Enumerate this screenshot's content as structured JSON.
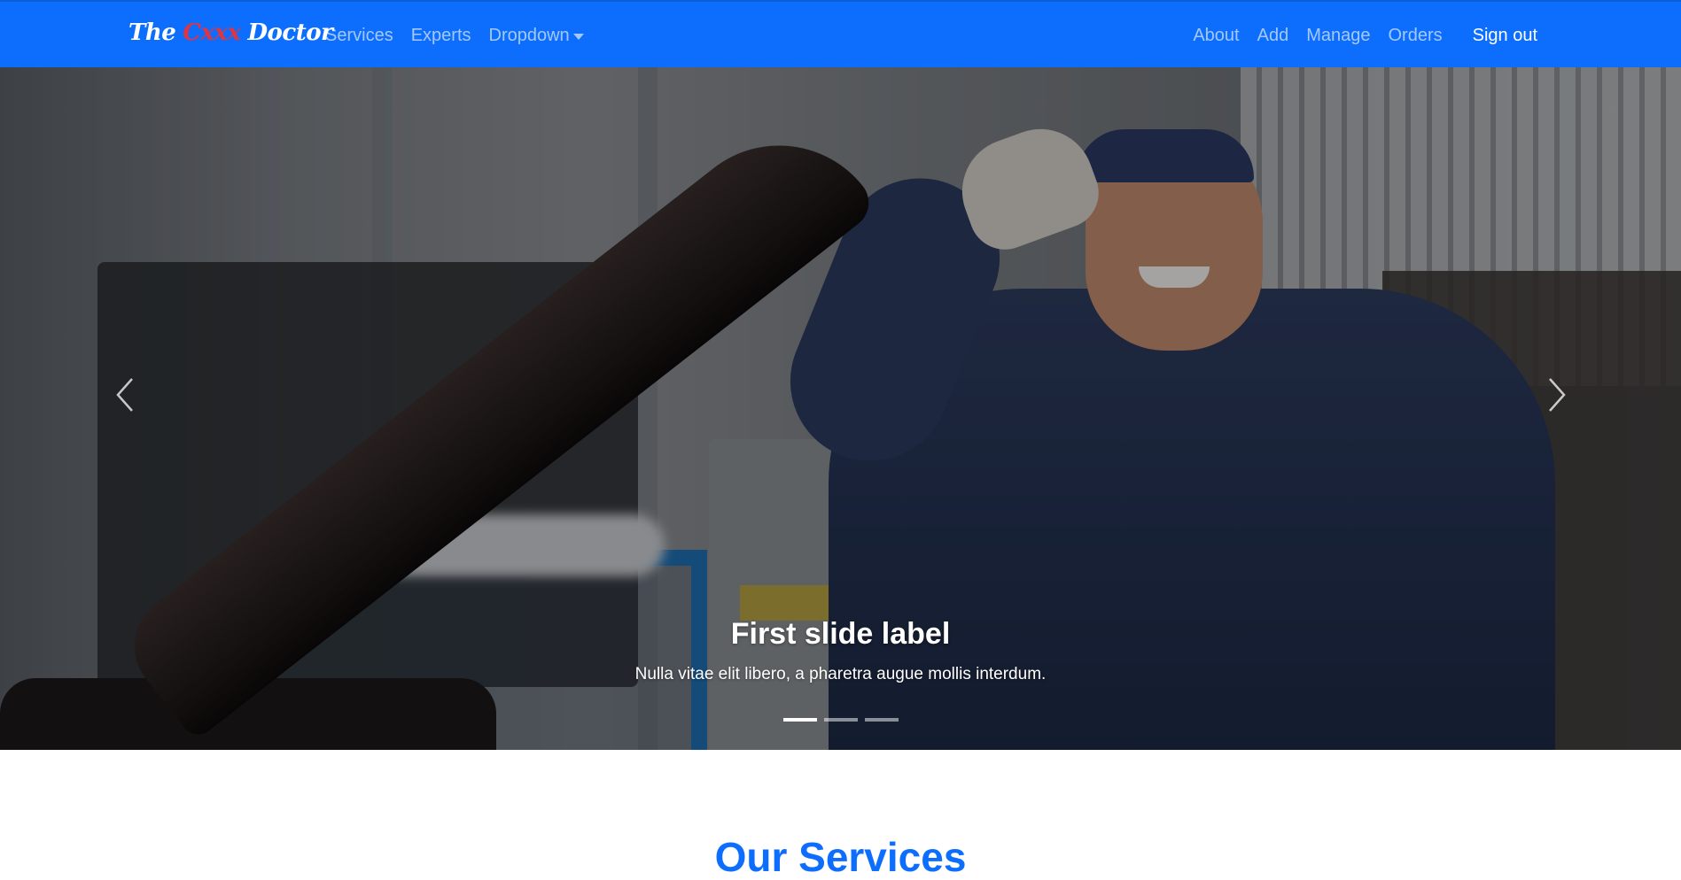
{
  "brand": {
    "word1": "The",
    "word2": "Cxxx",
    "word3": "Doctor",
    "colors": {
      "primary": "#ffffff",
      "accent": "#dc3545"
    }
  },
  "nav": {
    "left_items": [
      {
        "label": "Services"
      },
      {
        "label": "Experts"
      },
      {
        "label": "Dropdown"
      }
    ],
    "right_items": [
      {
        "label": "About"
      },
      {
        "label": "Add"
      },
      {
        "label": "Manage"
      },
      {
        "label": "Orders"
      }
    ],
    "sign_out_label": "Sign out",
    "dropdown_icon": "caret-down-icon"
  },
  "carousel": {
    "caption_title": "First slide label",
    "caption_text": "Nulla vitae elit libero, a pharetra augue mollis interdum.",
    "active_slide": 1,
    "slide_count": 3,
    "prev_icon": "chevron-left-icon",
    "next_icon": "chevron-right-icon"
  },
  "section": {
    "title": "Our Services"
  },
  "theme": {
    "navbar_bg": "#0d6efd",
    "heading_color": "#0d6efd"
  }
}
